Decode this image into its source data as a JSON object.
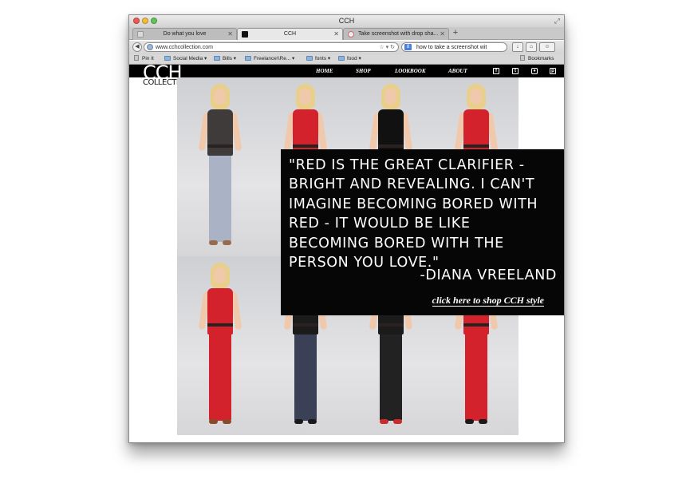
{
  "window": {
    "title": "CCH"
  },
  "tabs": [
    {
      "label": "Do what you love",
      "active": false
    },
    {
      "label": "CCH",
      "active": true
    },
    {
      "label": "Take screenshot with drop sha...",
      "active": false
    }
  ],
  "toolbar": {
    "url": "www.cchcollection.com",
    "search_value": "how to take a screenshot wit"
  },
  "bookmarks": [
    {
      "label": "Pin It",
      "type": "pin"
    },
    {
      "label": "Social Media",
      "type": "folder"
    },
    {
      "label": "Bills",
      "type": "folder"
    },
    {
      "label": "Freelance\\\\Re...",
      "type": "folder"
    },
    {
      "label": "fonts",
      "type": "folder"
    },
    {
      "label": "food",
      "type": "folder"
    }
  ],
  "bookmarks_menu": "Bookmarks",
  "site": {
    "logo_main": "CCH",
    "logo_sub": "COLLECTION",
    "nav": [
      "HOME",
      "SHOP",
      "LOOKBOOK",
      "ABOUT"
    ],
    "social_icons": [
      "facebook-icon",
      "twitter-icon",
      "instagram-icon",
      "pinterest-icon"
    ]
  },
  "quote": {
    "text": "\"RED IS THE GREAT CLARIFIER -\nBRIGHT AND REVEALING. I CAN'T\nIMAGINE BECOMING BORED WITH\nRED - IT WOULD BE LIKE\nBECOMING BORED WITH THE\nPERSON YOU LOVE.\"",
    "author": "-DIANA VREELAND",
    "link": "click here to shop CCH style"
  },
  "colors": {
    "accent_red": "#d4222c",
    "black": "#060606"
  },
  "photos": [
    {
      "top": "#3f3b3a",
      "legs": "#aab3c6",
      "shoes": "#9a6a4a"
    },
    {
      "top": "#d4222c",
      "legs": "#d4222c",
      "shoes": "#2a2a2a"
    },
    {
      "top": "#111111",
      "legs": "#d4222c",
      "shoes": "#2a2a2a"
    },
    {
      "top": "#d4222c",
      "legs": "#d4222c",
      "shoes": "#2a2a2a"
    },
    {
      "top": "#d4222c",
      "legs": "#d4222c",
      "shoes": "#8a4a2a"
    },
    {
      "top": "#1b1b1b",
      "legs": "#3a4055",
      "shoes": "#1a1a1a"
    },
    {
      "top": "#1b1b1b",
      "legs": "#222222",
      "shoes": "#cc2a2a"
    },
    {
      "top": "#d4222c",
      "legs": "#d4222c",
      "shoes": "#1a1a1a"
    }
  ]
}
